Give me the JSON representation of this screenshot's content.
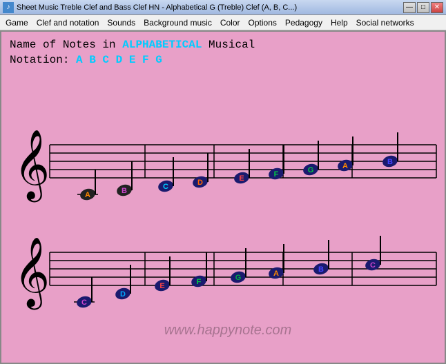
{
  "window": {
    "title": "Sheet Music Treble Clef and Bass Clef HN - Alphabetical G (Treble) Clef (A, B, C...)",
    "icon": "♪"
  },
  "menu": {
    "items": [
      "Game",
      "Clef and notation",
      "Sounds",
      "Background music",
      "Color",
      "Options",
      "Pedagogy",
      "Help",
      "Social networks"
    ]
  },
  "header": {
    "line1_prefix": "Name of Notes in ",
    "line1_highlight": "ALPHABETICAL",
    "line1_suffix": " Musical",
    "line2_prefix": "Notation: ",
    "line2_notes": "A B C D E F G"
  },
  "watermark": "www.happynote.com",
  "window_controls": {
    "minimize": "—",
    "maximize": "□",
    "close": "✕"
  },
  "notes_row1": [
    {
      "letter": "A",
      "color": "#ff8800"
    },
    {
      "letter": "B",
      "color": "#cc00cc"
    },
    {
      "letter": "C",
      "color": "#cc00cc"
    },
    {
      "letter": "D",
      "color": "#ff6600"
    },
    {
      "letter": "E",
      "color": "#ff4444"
    },
    {
      "letter": "F",
      "color": "#00cc00"
    },
    {
      "letter": "G",
      "color": "#00cc44"
    },
    {
      "letter": "A",
      "color": "#ff8800"
    },
    {
      "letter": "B",
      "color": "#4444ff"
    }
  ],
  "notes_row2": [
    {
      "letter": "C",
      "color": "#cc44cc"
    },
    {
      "letter": "D",
      "color": "#00aaff"
    },
    {
      "letter": "E",
      "color": "#ff4444"
    },
    {
      "letter": "F",
      "color": "#00cc00"
    },
    {
      "letter": "G",
      "color": "#00aa44"
    },
    {
      "letter": "A",
      "color": "#ff8800"
    },
    {
      "letter": "B",
      "color": "#4444ff"
    },
    {
      "letter": "C",
      "color": "#cc44cc"
    }
  ]
}
